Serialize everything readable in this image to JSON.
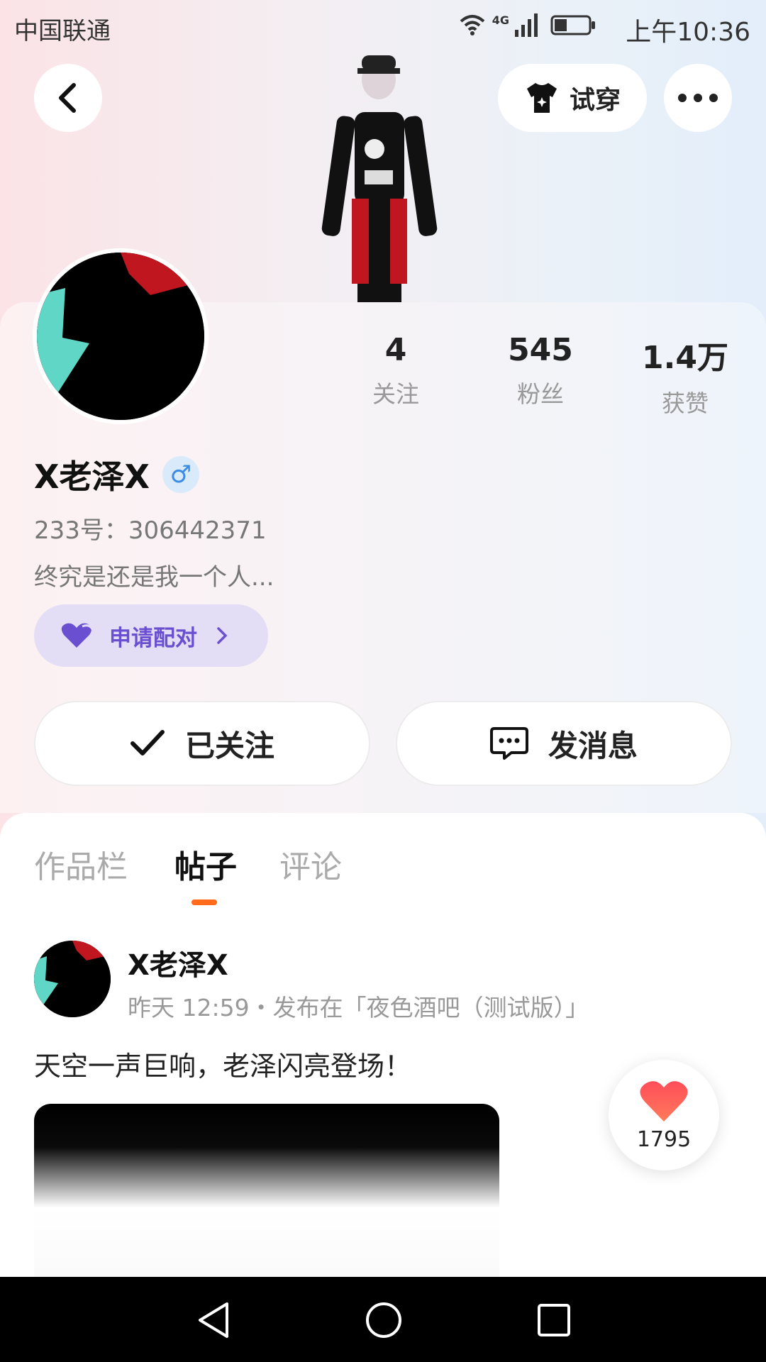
{
  "status_bar": {
    "carrier": "中国联通",
    "network": "4G",
    "time": "上午10:36"
  },
  "header": {
    "try_on_label": "试穿"
  },
  "profile": {
    "stats": [
      {
        "value": "4",
        "label": "关注"
      },
      {
        "value": "545",
        "label": "粉丝"
      },
      {
        "value": "1.4万",
        "label": "获赞"
      }
    ],
    "name": "X老泽X",
    "gender_symbol": "♂",
    "id_text": "233号：306442371",
    "bio": "终究是还是我一个人...",
    "pair_label": "申请配对",
    "follow_label": "已关注",
    "message_label": "发消息"
  },
  "tabs": [
    {
      "label": "作品栏",
      "active": false
    },
    {
      "label": "帖子",
      "active": true
    },
    {
      "label": "评论",
      "active": false
    }
  ],
  "post": {
    "author": "X老泽X",
    "meta": "昨天 12:59・发布在「夜色酒吧（测试版）」",
    "text": "天空一声巨响，老泽闪亮登场！",
    "likes": "1795"
  },
  "colors": {
    "accent": "#ff6b1a",
    "pair_purple": "#6a4fd0",
    "like_red": "#ff3b4e"
  }
}
